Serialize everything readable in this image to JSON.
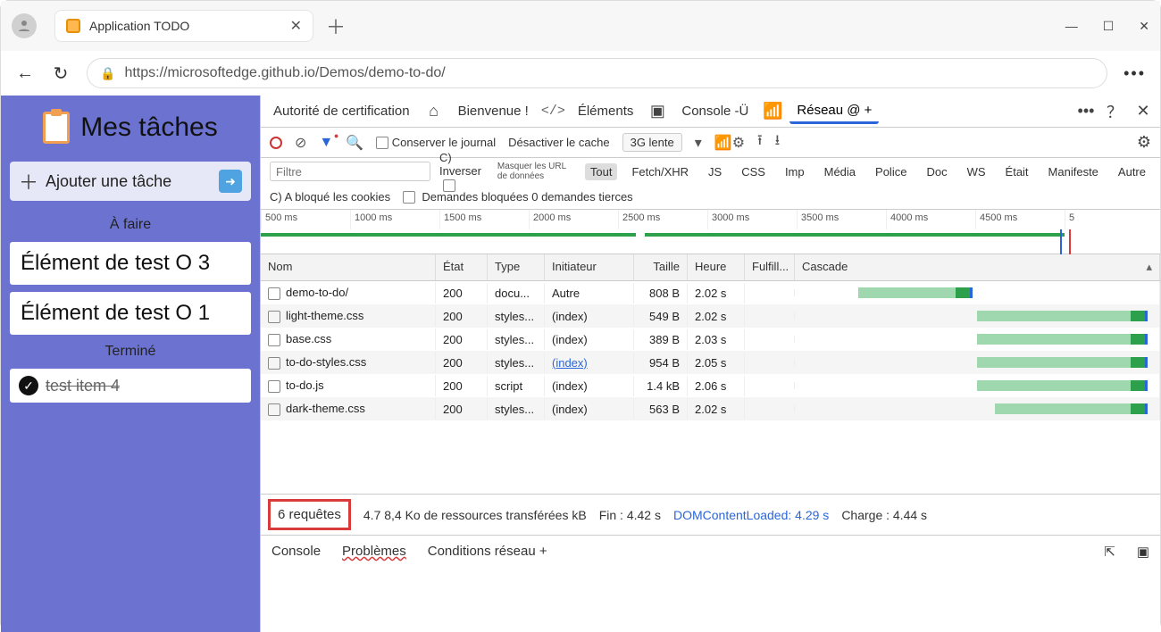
{
  "browser": {
    "tab_title": "Application TODO",
    "url_display": "https://microsoftedge.github.io/Demos/demo-to-do/"
  },
  "todo": {
    "title": "Mes tâches",
    "add_placeholder": "Ajouter une tâche",
    "section_todo": "À faire",
    "section_done": "Terminé",
    "tasks": [
      "Élément de test O 3",
      "Élément de test O 1"
    ],
    "done": [
      "test item 4"
    ]
  },
  "devtools": {
    "tabs": {
      "authority": "Autorité de certification",
      "welcome": "Bienvenue !",
      "elements": "Éléments",
      "console": "Console -Ü",
      "network": "Réseau @ +"
    },
    "toolbar": {
      "preserve_log": "Conserver le journal",
      "disable_cache": "Désactiver le cache",
      "throttle": "3G lente"
    },
    "filter": {
      "placeholder": "Filtre",
      "invert": "C) Inverser",
      "hide_data_urls": "Masquer les URL de données",
      "chips": [
        "Tout",
        "Fetch/XHR",
        "JS",
        "CSS",
        "Imp",
        "Média",
        "Police",
        "Doc",
        "WS",
        "Était",
        "Manifeste",
        "Autre"
      ]
    },
    "cookies_row": {
      "blocked_cookies": "C) A bloqué les cookies",
      "blocked_requests": "Demandes bloquées 0 demandes tierces"
    },
    "timeline_ticks": [
      "500 ms",
      "1000 ms",
      "1500 ms",
      "2000 ms",
      "2500 ms",
      "3000 ms",
      "3500 ms",
      "4000 ms",
      "4500 ms",
      "5"
    ],
    "columns": {
      "name": "Nom",
      "status": "État",
      "type": "Type",
      "initiator": "Initiateur",
      "size": "Taille",
      "time": "Heure",
      "fulfilled": "Fulfill...",
      "waterfall": "Cascade"
    },
    "rows": [
      {
        "name": "demo-to-do/",
        "icon": "doc",
        "status": "200",
        "type": "docu...",
        "initiator": "Autre",
        "initiator_link": false,
        "size": "808 B",
        "time": "2.02 s",
        "bar_start": 16,
        "bar_pale": 32,
        "bar_solid": 2
      },
      {
        "name": "light-theme.css",
        "icon": "css",
        "status": "200",
        "type": "styles...",
        "initiator": "(index)",
        "initiator_link": false,
        "size": "549 B",
        "time": "2.02 s",
        "bar_start": 50,
        "bar_pale": 48,
        "bar_solid": 2
      },
      {
        "name": "base.css",
        "icon": "css",
        "status": "200",
        "type": "styles...",
        "initiator": "(index)",
        "initiator_link": false,
        "size": "389 B",
        "time": "2.03 s",
        "bar_start": 50,
        "bar_pale": 48,
        "bar_solid": 2
      },
      {
        "name": "to-do-styles.css",
        "icon": "css",
        "status": "200",
        "type": "styles...",
        "initiator": "(index)",
        "initiator_link": true,
        "size": "954 B",
        "time": "2.05 s",
        "bar_start": 50,
        "bar_pale": 48,
        "bar_solid": 2
      },
      {
        "name": "to-do.js",
        "icon": "js",
        "status": "200",
        "type": "script",
        "initiator": "(index)",
        "initiator_link": false,
        "size": "1.4 kB",
        "time": "2.06 s",
        "bar_start": 50,
        "bar_pale": 48,
        "bar_solid": 2
      },
      {
        "name": "dark-theme.css",
        "icon": "css",
        "status": "200",
        "type": "styles...",
        "initiator": "(index)",
        "initiator_link": false,
        "size": "563 B",
        "time": "2.02 s",
        "bar_start": 55,
        "bar_pale": 43,
        "bar_solid": 2
      }
    ],
    "summary": {
      "requests": "6 requêtes",
      "transferred": "4.7 8,4 Ko de ressources transférées kB",
      "finish": "Fin : 4.42 s",
      "dcl": "DOMContentLoaded: 4.29 s",
      "load": "Charge : 4.44 s"
    },
    "drawer": {
      "console": "Console",
      "problems": "Problèmes",
      "network_conditions": "Conditions réseau +"
    }
  }
}
